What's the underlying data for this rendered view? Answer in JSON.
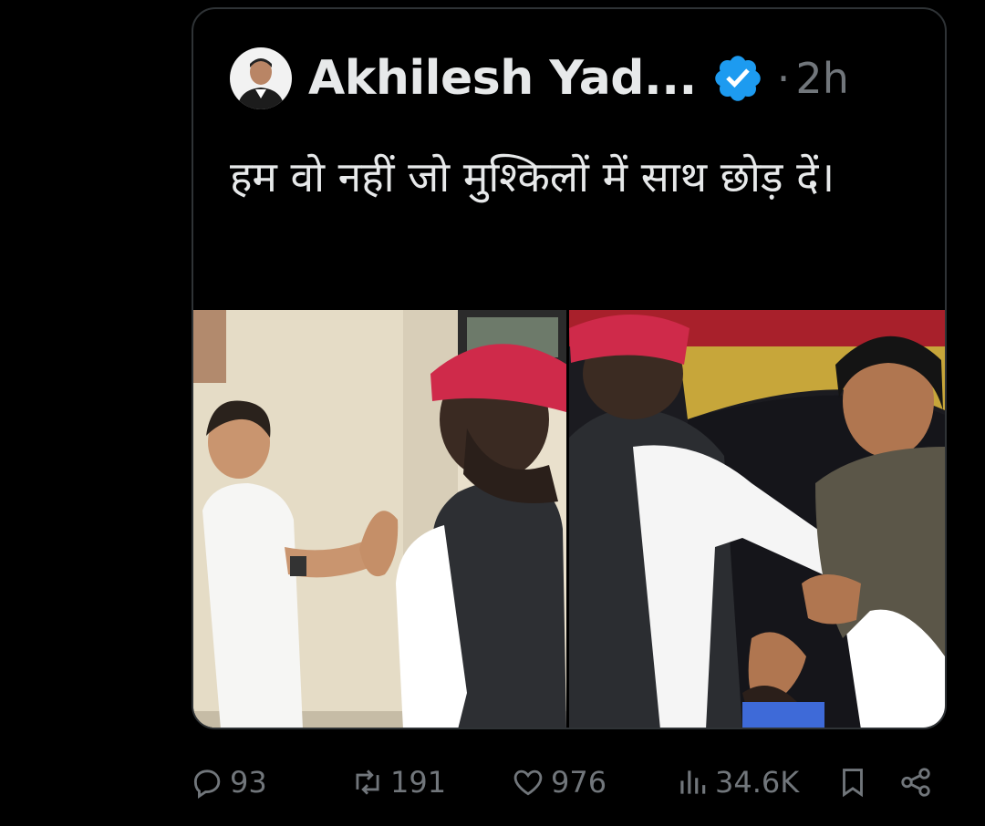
{
  "tweet": {
    "author_name": "Akhilesh Yad...",
    "verified_icon": "verified-badge-icon",
    "dot": "·",
    "timestamp": "2h",
    "text": "हम वो नहीं जो मुश्किलों में साथ छोड़ दें।"
  },
  "media": {
    "images": [
      "photo-left",
      "photo-right"
    ]
  },
  "actions": {
    "replies": "93",
    "retweets": "191",
    "likes": "976",
    "views": "34.6K",
    "bookmark_icon": "bookmark-icon",
    "share_icon": "share-icon"
  },
  "colors": {
    "background": "#000000",
    "text": "#e7e9ea",
    "muted": "#71767b",
    "border": "#2f3336",
    "verified": "#1d9bf0"
  }
}
